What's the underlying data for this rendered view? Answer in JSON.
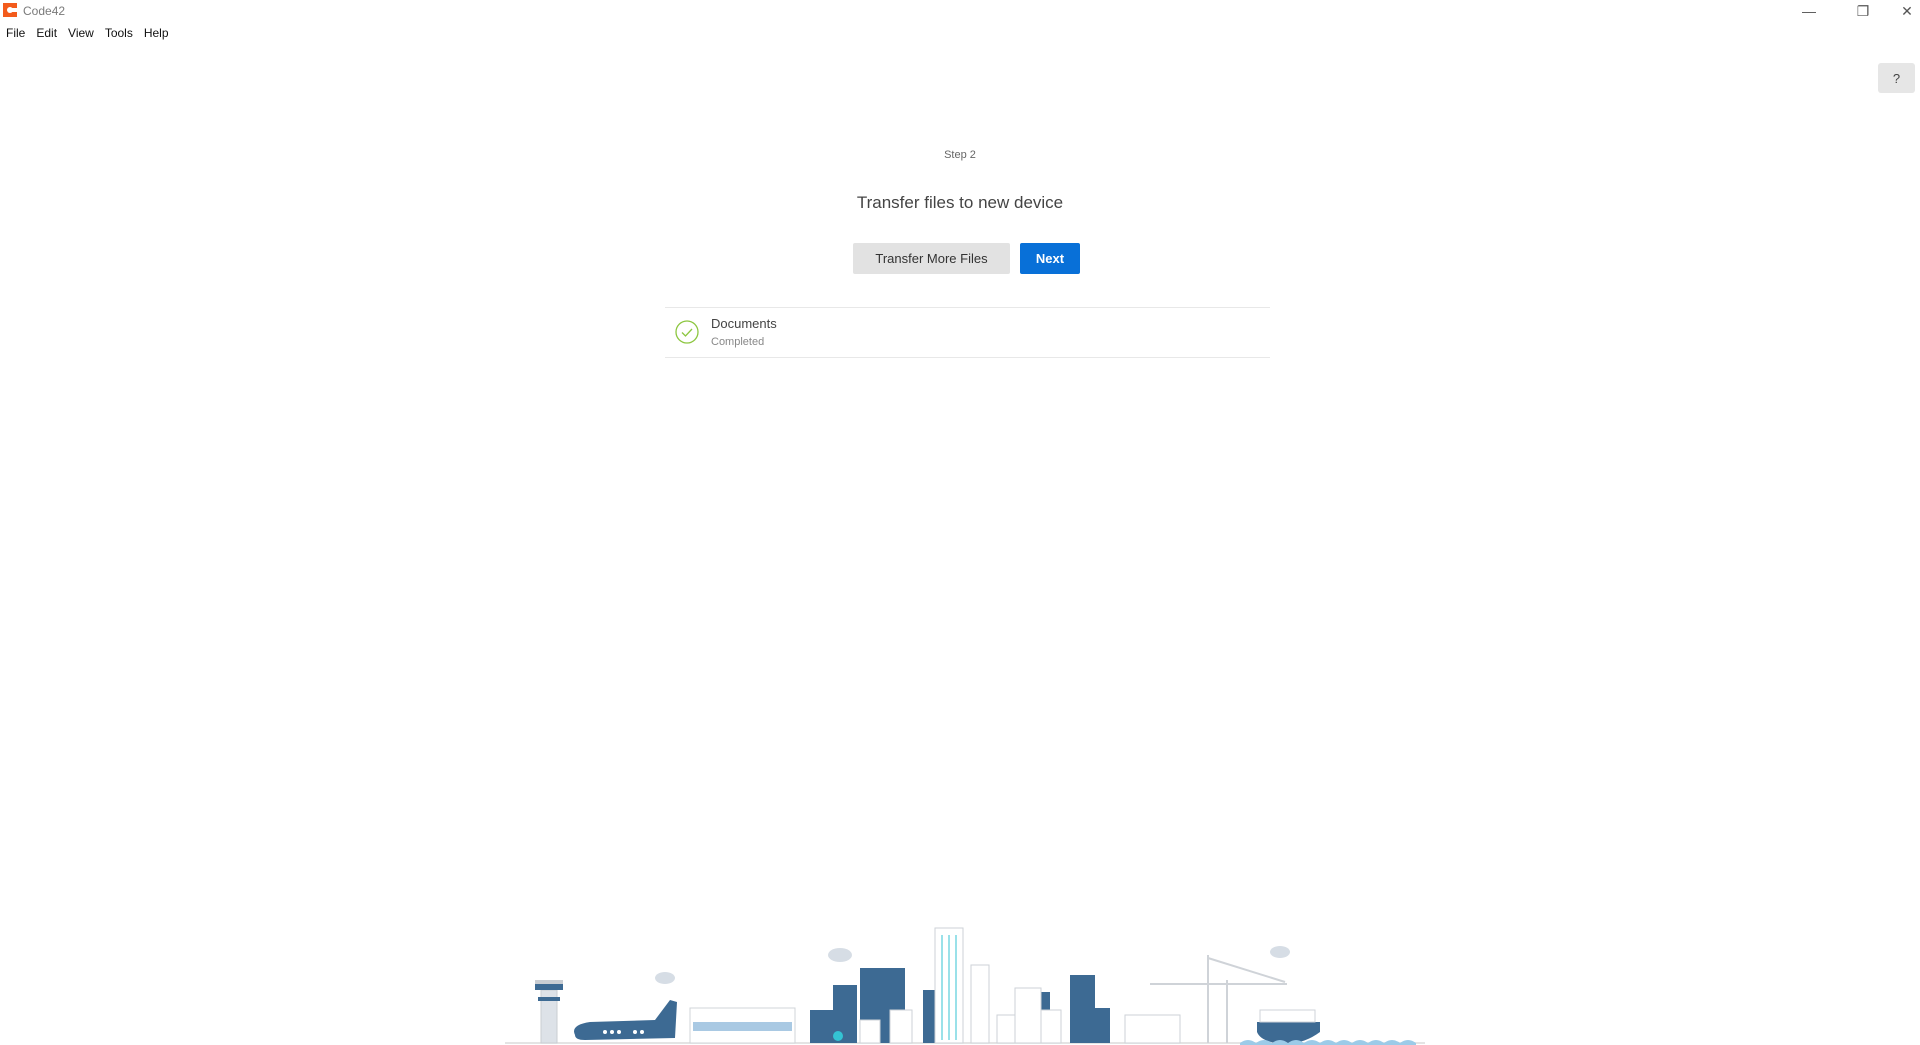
{
  "window": {
    "title": "Code42",
    "controls": {
      "minimize": "—",
      "restore": "❐",
      "close": "✕"
    }
  },
  "menubar": {
    "items": [
      {
        "label": "File"
      },
      {
        "label": "Edit"
      },
      {
        "label": "View"
      },
      {
        "label": "Tools"
      },
      {
        "label": "Help"
      }
    ]
  },
  "help_button": {
    "label": "?"
  },
  "main": {
    "step": "Step 2",
    "title": "Transfer files to new device",
    "buttons": {
      "transfer_more": "Transfer More Files",
      "next": "Next"
    },
    "transfers": [
      {
        "name": "Documents",
        "status": "Completed",
        "icon": "check-circle-icon"
      }
    ]
  },
  "colors": {
    "brand": "#f35b1c",
    "primary_button": "#0870d8",
    "success": "#8cc63f",
    "illustration_dark": "#3d6a93",
    "illustration_accent": "#34c3d3",
    "water": "#9ccbe8"
  },
  "illustration": {
    "name": "city-skyline-illustration"
  }
}
